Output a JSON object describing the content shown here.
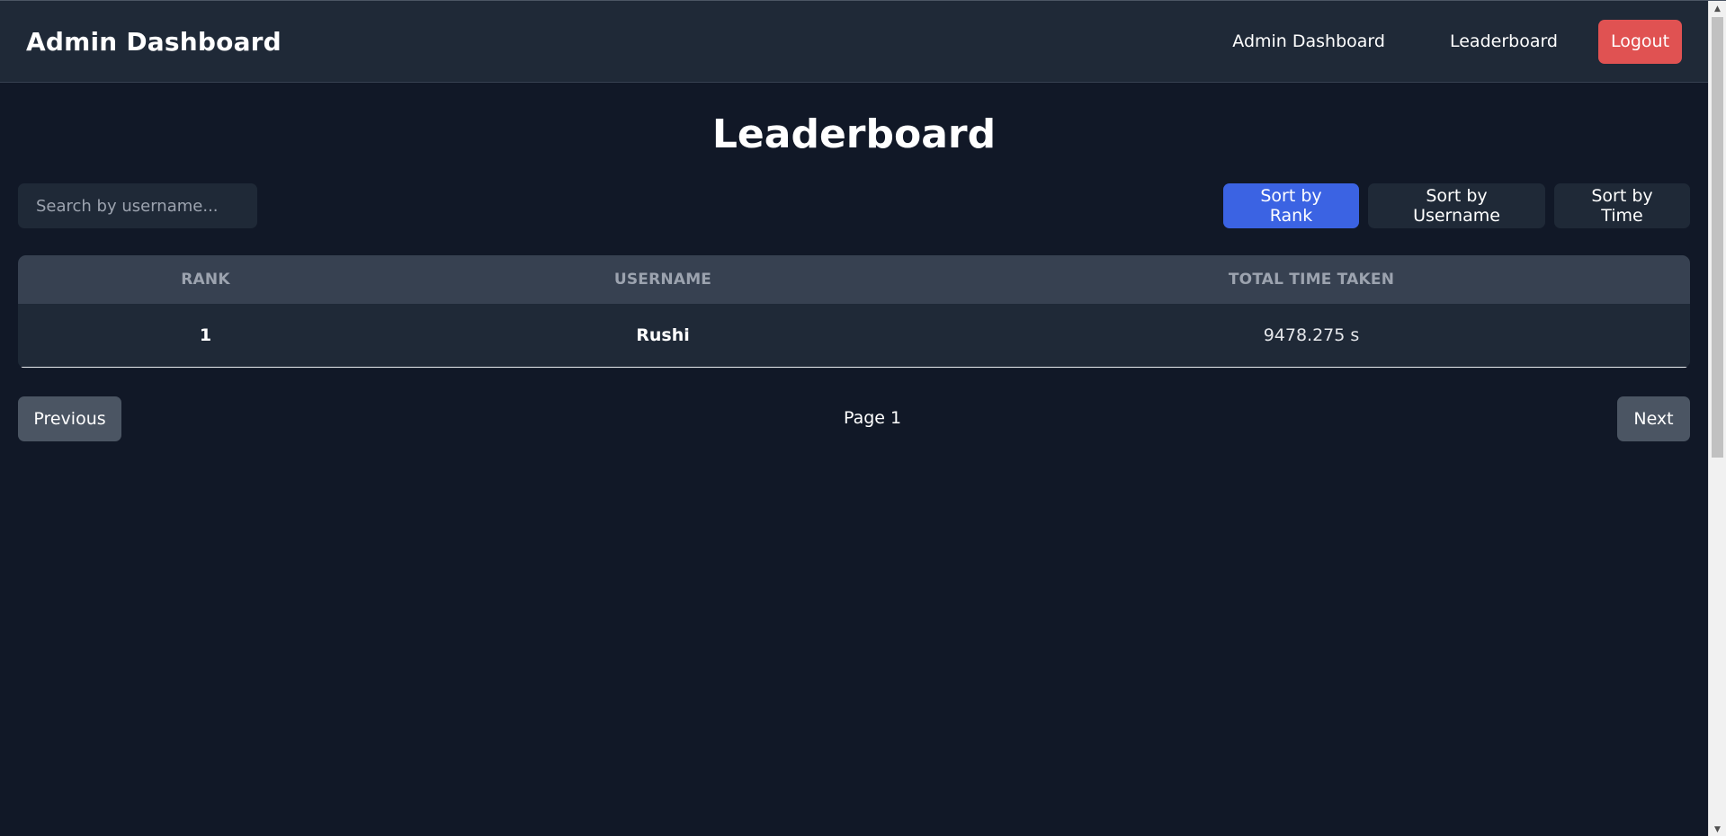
{
  "header": {
    "brand": "Admin Dashboard",
    "nav": [
      {
        "label": "Admin Dashboard"
      },
      {
        "label": "Leaderboard"
      }
    ],
    "logout_label": "Logout"
  },
  "main": {
    "title": "Leaderboard",
    "search": {
      "placeholder": "Search by username...",
      "value": ""
    },
    "sort_buttons": [
      {
        "label": "Sort by Rank",
        "active": true
      },
      {
        "label": "Sort by Username",
        "active": false
      },
      {
        "label": "Sort by Time",
        "active": false
      }
    ],
    "table": {
      "columns": [
        "RANK",
        "USERNAME",
        "TOTAL TIME TAKEN"
      ],
      "rows": [
        {
          "rank": "1",
          "username": "Rushi",
          "time": "9478.275 s"
        }
      ]
    },
    "pagination": {
      "previous_label": "Previous",
      "page_label": "Page 1",
      "next_label": "Next"
    }
  },
  "colors": {
    "background": "#111827",
    "navbar": "#1f2937",
    "accent": "#3b63e3",
    "logout": "#e05252",
    "pagination_button": "#4b5563"
  }
}
